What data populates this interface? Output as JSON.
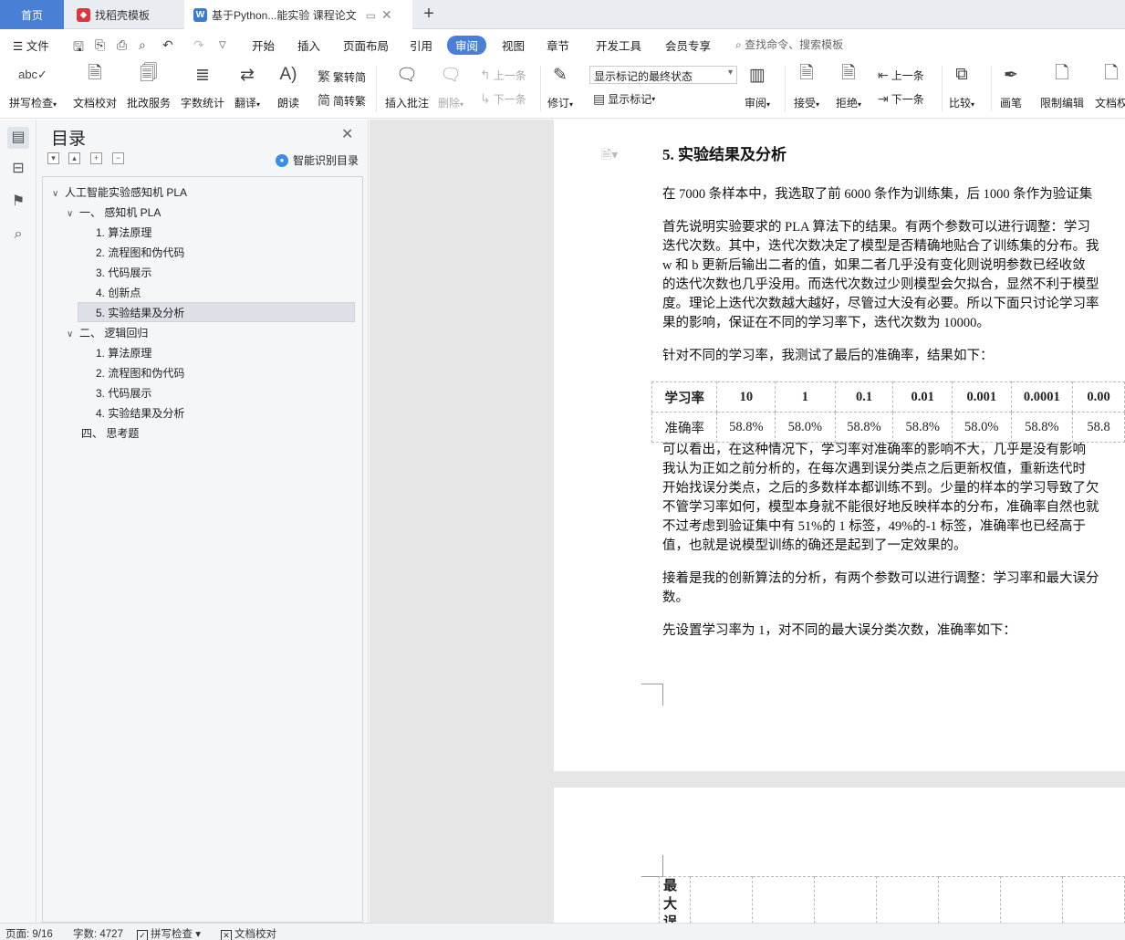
{
  "tabs": {
    "home": "首页",
    "template": "找稻壳模板",
    "document": "基于Python...能实验 课程论文",
    "add": "+"
  },
  "menu": {
    "file": "文件",
    "items": [
      "开始",
      "插入",
      "页面布局",
      "引用",
      "审阅",
      "视图",
      "章节",
      "开发工具",
      "会员专享"
    ],
    "active": "审阅",
    "search": "查找命令、搜索模板"
  },
  "ribbon": {
    "spellcheck": "拼写检查",
    "doc_proof": "文档校对",
    "correction": "批改服务",
    "word_count": "字数统计",
    "translate": "翻译",
    "read_aloud": "朗读",
    "to_traditional": "繁转简",
    "to_simplified": "简转繁",
    "insert_comment": "插入批注",
    "delete": "删除",
    "prev_comment": "上一条",
    "next_comment": "下一条",
    "track": "修订",
    "markup_mode": "显示标记的最终状态",
    "show_markup": "显示标记",
    "review": "审阅",
    "accept": "接受",
    "reject": "拒绝",
    "prev_change": "上一条",
    "next_change": "下一条",
    "compare": "比较",
    "pen": "画笔",
    "restrict_edit": "限制编辑",
    "doc_rights": "文档权"
  },
  "toc": {
    "title": "目录",
    "smart": "智能识别目录",
    "items": [
      {
        "label": "人工智能实验感知机 PLA",
        "level": 0
      },
      {
        "label": "一、  感知机 PLA",
        "level": 1
      },
      {
        "label": "1. 算法原理",
        "level": 2
      },
      {
        "label": "2. 流程图和伪代码",
        "level": 2
      },
      {
        "label": "3. 代码展示",
        "level": 2
      },
      {
        "label": "4. 创新点",
        "level": 2
      },
      {
        "label": "5. 实验结果及分析",
        "level": 2
      },
      {
        "label": "二、  逻辑回归",
        "level": 1
      },
      {
        "label": "1. 算法原理",
        "level": 2
      },
      {
        "label": "2. 流程图和伪代码",
        "level": 2
      },
      {
        "label": "3. 代码展示",
        "level": 2
      },
      {
        "label": "4. 实验结果及分析",
        "level": 2
      },
      {
        "label": "四、  思考题",
        "level": 1
      }
    ]
  },
  "doc": {
    "heading": "5.  实验结果及分析",
    "p1": [
      "在 7000 条样本中，我选取了前 6000 条作为训练集，后 1000 条作为验证集"
    ],
    "p2": [
      "首先说明实验要求的 PLA 算法下的结果。有两个参数可以进行调整：学习",
      "迭代次数。其中，迭代次数决定了模型是否精确地贴合了训练集的分布。我",
      "w 和 b 更新后输出二者的值，如果二者几乎没有变化则说明参数已经收敛",
      "的迭代次数也几乎没用。而迭代次数过少则模型会欠拟合，显然不利于模型",
      "度。理论上迭代次数越大越好，尽管过大没有必要。所以下面只讨论学习率",
      "果的影响，保证在不同的学习率下，迭代次数为 10000。"
    ],
    "p3": [
      "针对不同的学习率，我测试了最后的准确率，结果如下："
    ],
    "table": {
      "row_header": "学习率",
      "col_values": [
        "10",
        "1",
        "0.1",
        "0.01",
        "0.001",
        "0.0001",
        "0.00"
      ],
      "acc_header": "准确率",
      "acc_values": [
        "58.8%",
        "58.0%",
        "58.8%",
        "58.8%",
        "58.0%",
        "58.8%",
        "58.8"
      ]
    },
    "p4": [
      "可以看出，在这种情况下，学习率对准确率的影响不大，几乎是没有影响",
      "我认为正如之前分析的，在每次遇到误分类点之后更新权值，重新迭代时",
      "开始找误分类点，之后的多数样本都训练不到。少量的样本的学习导致了欠",
      "不管学习率如何，模型本身就不能很好地反映样本的分布，准确率自然也就",
      "不过考虑到验证集中有 51%的 1 标签，49%的-1 标签，准确率也已经高于",
      "值，也就是说模型训练的确还是起到了一定效果的。"
    ],
    "p5": [
      "接着是我的创新算法的分析，有两个参数可以进行调整：学习率和最大误分",
      "数。"
    ],
    "p6": [
      "先设置学习率为 1，对不同的最大误分类次数，准确率如下："
    ],
    "page2_cell": "最\n大\n误"
  },
  "status": {
    "page": "页面: 9/16",
    "words": "字数: 4727",
    "spell": "拼写检查",
    "proof": "文档校对"
  }
}
